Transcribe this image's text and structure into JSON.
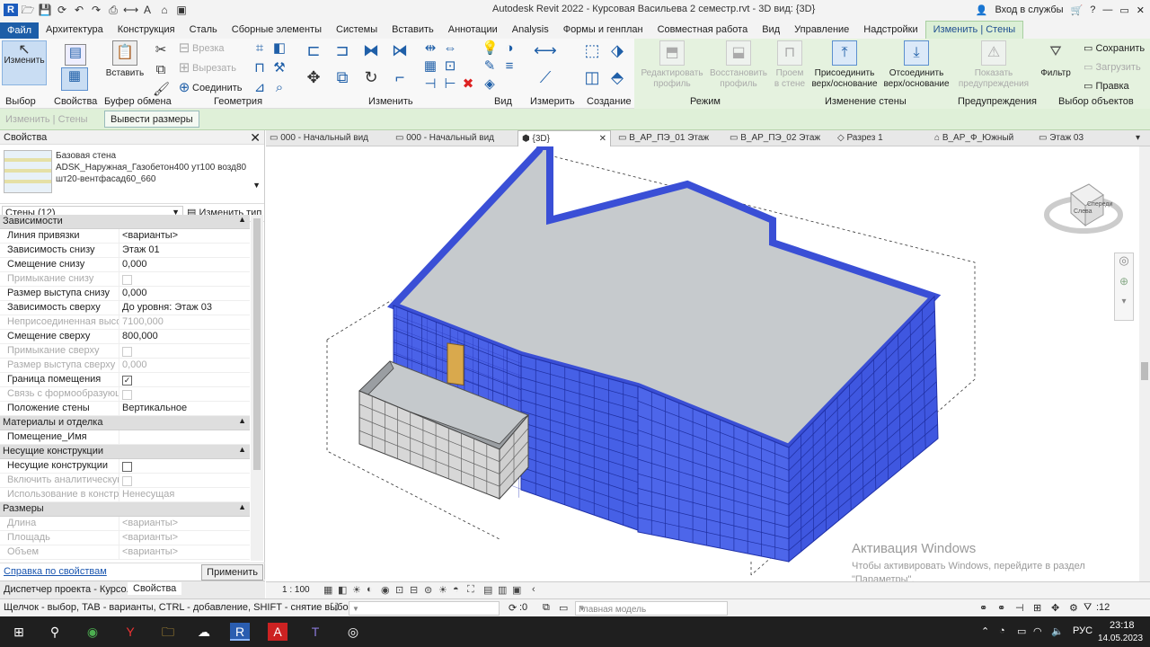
{
  "window": {
    "title": "Autodesk Revit 2022 - Курсовая Васильева 2 семестр.rvt - 3D вид: {3D}",
    "signin": "Вход в службы",
    "help": "?",
    "app_icon": "R"
  },
  "ribbon_tabs": [
    "Файл",
    "Архитектура",
    "Конструкция",
    "Сталь",
    "Сборные элементы",
    "Системы",
    "Вставить",
    "Аннотации",
    "Analysis",
    "Формы и генплан",
    "Совместная работа",
    "Вид",
    "Управление",
    "Надстройки",
    "Изменить | Стены"
  ],
  "ribbon": {
    "select": {
      "modify": "Изменить",
      "label": "Выбор"
    },
    "properties": {
      "label": "Свойства"
    },
    "clipboard": {
      "paste": "Вставить",
      "label": "Буфер обмена"
    },
    "geometry": {
      "cut": "Врезка",
      "cut2": "Вырезать",
      "join": "Соединить",
      "label": "Геометрия"
    },
    "modify": {
      "label": "Изменить"
    },
    "view": {
      "label": "Вид"
    },
    "measure": {
      "label": "Измерить"
    },
    "create": {
      "label": "Создание"
    },
    "mode": {
      "edit_profile": "Редактировать профиль",
      "reset_profile": "Восстановить профиль",
      "label": "Режим"
    },
    "modify_wall": {
      "opening": "Проем в стене",
      "attach": "Присоединить верх/основание",
      "detach": "Отсоединить верх/основание",
      "label": "Изменение стены"
    },
    "warnings": {
      "show": "Показать предупреждения",
      "label": "Предупреждения"
    },
    "selection": {
      "filter": "Фильтр",
      "save": "Сохранить",
      "load": "Загрузить",
      "edit": "Правка",
      "label": "Выбор объектов"
    }
  },
  "options_bar": {
    "modify_walls": "Изменить | Стены",
    "show_dims": "Вывести размеры"
  },
  "properties": {
    "title": "Свойства",
    "type_family": "Базовая стена",
    "type_name": "ADSK_Наружная_Газобетон400 ут100 возд80 шт20-вентфасад60_660",
    "filter": "Стены (12)",
    "edit_type": "Изменить тип",
    "sections": [
      {
        "title": "Зависимости",
        "rows": [
          {
            "k": "Линия привязки",
            "v": "<варианты>",
            "dis": false
          },
          {
            "k": "Зависимость снизу",
            "v": "Этаж 01",
            "dis": false
          },
          {
            "k": "Смещение снизу",
            "v": "0,000",
            "dis": false
          },
          {
            "k": "Примыкание снизу",
            "v": "",
            "cb": "empty",
            "dis": true
          },
          {
            "k": "Размер выступа снизу",
            "v": "0,000",
            "dis": false
          },
          {
            "k": "Зависимость сверху",
            "v": "До уровня: Этаж 03",
            "dis": false
          },
          {
            "k": "Неприсоединенная высо...",
            "v": "7100,000",
            "dis": true
          },
          {
            "k": "Смещение сверху",
            "v": "800,000",
            "dis": false
          },
          {
            "k": "Примыкание сверху",
            "v": "",
            "cb": "empty",
            "dis": true
          },
          {
            "k": "Размер выступа сверху",
            "v": "0,000",
            "dis": true
          },
          {
            "k": "Граница помещения",
            "v": "",
            "cb": "checked",
            "dis": false
          },
          {
            "k": "Связь с формообразующ...",
            "v": "",
            "cb": "empty",
            "dis": true
          },
          {
            "k": "Положение стены",
            "v": "Вертикальное",
            "dis": false
          }
        ]
      },
      {
        "title": "Материалы и отделка",
        "rows": [
          {
            "k": "Помещение_Имя",
            "v": "",
            "dis": false
          }
        ]
      },
      {
        "title": "Несущие конструкции",
        "rows": [
          {
            "k": "Несущие конструкции",
            "v": "",
            "cb": "empty",
            "dis": false
          },
          {
            "k": "Включить аналитическую...",
            "v": "",
            "cb": "empty",
            "dis": true
          },
          {
            "k": "Использование в констру...",
            "v": "Ненесущая",
            "dis": true
          }
        ]
      },
      {
        "title": "Размеры",
        "rows": [
          {
            "k": "Длина",
            "v": "<варианты>",
            "dis": true
          },
          {
            "k": "Площадь",
            "v": "<варианты>",
            "dis": true
          },
          {
            "k": "Объем",
            "v": "<варианты>",
            "dis": true
          }
        ]
      }
    ],
    "help_link": "Справка по свойствам",
    "apply": "Применить",
    "bottom_tabs": [
      "Диспетчер проекта - Курсо...",
      "Свойства"
    ]
  },
  "view_tabs": [
    "000 - Начальный вид",
    "000 - Начальный вид",
    "{3D}",
    "В_АР_ПЭ_01 Этаж",
    "В_АР_ПЭ_02 Этаж",
    "Разрез 1",
    "В_АР_Ф_Южный",
    "Этаж 03"
  ],
  "viewcube": {
    "left": "Слева",
    "front": "Спереди"
  },
  "view_controls": {
    "scale": "1 : 100"
  },
  "status": {
    "hint": "Щелчок - выбор, TAB - варианты, CTRL - добавление, SHIFT - снятие выбора.",
    "count": ":0",
    "model": "Главная модель",
    "filter_count": ":12"
  },
  "watermark": {
    "title": "Активация Windows",
    "text1": "Чтобы активировать Windows, перейдите в раздел",
    "text2": "\"Параметры\"."
  },
  "tray": {
    "lang": "РУС",
    "time": "23:18",
    "date": "14.05.2023"
  },
  "colors": {
    "wall_blue": "#3f5fe6",
    "roof_gray": "#c8ccd0",
    "door": "#d9a94d",
    "active_tab": "#dcefd6"
  }
}
